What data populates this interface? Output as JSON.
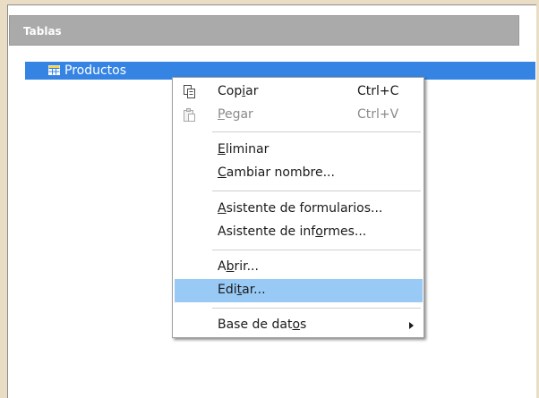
{
  "panel": {
    "title": "Tablas"
  },
  "tables": [
    {
      "label": "Productos"
    }
  ],
  "context_menu": {
    "items": [
      {
        "id": "copy",
        "label": "Copiar",
        "mnemonic_index": 3,
        "shortcut": "Ctrl+C",
        "icon": "copy-icon",
        "enabled": true
      },
      {
        "id": "paste",
        "label": "Pegar",
        "mnemonic_index": 0,
        "shortcut": "Ctrl+V",
        "icon": "paste-icon",
        "enabled": false
      },
      {
        "id": "delete",
        "label": "Eliminar",
        "mnemonic_index": 0,
        "enabled": true
      },
      {
        "id": "rename",
        "label": "Cambiar nombre...",
        "mnemonic_index": 0,
        "enabled": true
      },
      {
        "id": "form_wizard",
        "label": "Asistente de formularios...",
        "mnemonic_index": 0,
        "enabled": true
      },
      {
        "id": "report_wizard",
        "label": "Asistente de informes...",
        "mnemonic_index": 16,
        "enabled": true
      },
      {
        "id": "open",
        "label": "Abrir...",
        "mnemonic_index": 1,
        "enabled": true
      },
      {
        "id": "edit",
        "label": "Editar...",
        "mnemonic_index": 3,
        "enabled": true,
        "highlighted": true
      },
      {
        "id": "database",
        "label": "Base de datos",
        "mnemonic_index": 11,
        "enabled": true,
        "submenu": true
      }
    ]
  },
  "colors": {
    "selection": "#3584e4",
    "highlight": "#99c9f5",
    "header": "#aaaaaa"
  }
}
